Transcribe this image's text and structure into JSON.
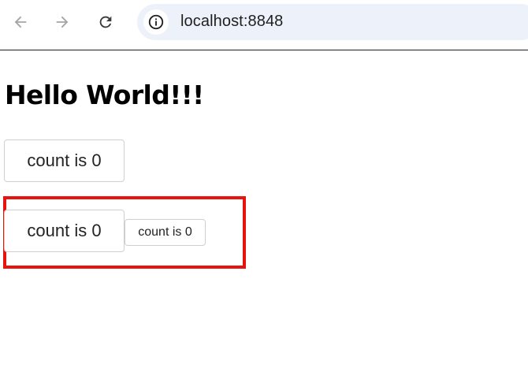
{
  "browser": {
    "back_icon": "arrow-left-icon",
    "forward_icon": "arrow-right-icon",
    "reload_icon": "reload-icon",
    "site_info_icon": "info-icon",
    "url": "localhost:8848"
  },
  "page": {
    "heading": "Hello World!!!",
    "buttons": [
      {
        "label": "count is 0"
      },
      {
        "label": "count is 0"
      },
      {
        "label": "count is 0"
      }
    ],
    "highlight_color": "#e8130f"
  }
}
